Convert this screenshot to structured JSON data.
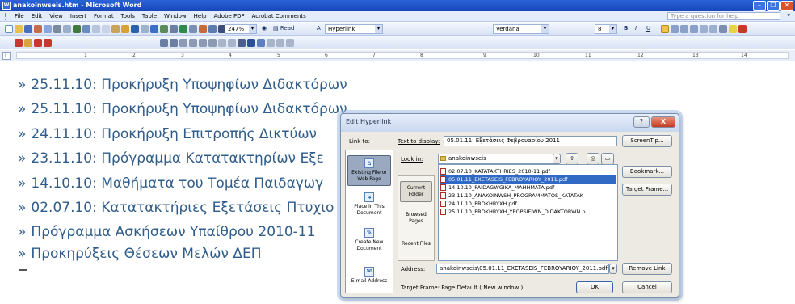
{
  "window": {
    "title": "anakoinwseis.htm - Microsoft Word",
    "controls": [
      "–",
      "❐",
      "✕"
    ]
  },
  "menu": {
    "items": [
      "File",
      "Edit",
      "View",
      "Insert",
      "Format",
      "Tools",
      "Table",
      "Window",
      "Help",
      "Adobe PDF",
      "Acrobat Comments"
    ],
    "help_placeholder": "Type a question for help"
  },
  "toolbar": {
    "zoom": "247%",
    "read_label": "Read",
    "style": "Hyperlink",
    "font": "Verdana",
    "size": "8"
  },
  "ruler": {
    "marks": [
      "1",
      "2",
      "3",
      "4",
      "5",
      "6",
      "7",
      "8",
      "9",
      "10",
      "11",
      "12",
      "13",
      "14"
    ]
  },
  "document": {
    "links": [
      {
        "text": "25.11.10: Προκήρυξη Υποψηφίων Διδακτόρων"
      },
      {
        "text": "25.11.10: Προκήρυξη Υποψηφίων Διδακτόρων"
      },
      {
        "text": "24.11.10: Προκήρυξη Επιτροπής Δικτύων"
      },
      {
        "text": "23.11.10: Πρόγραμμα Κατατακτηρίων Εξε"
      },
      {
        "text": "14.10.10: Μαθήματα του Τομέα Παιδαγωγ"
      },
      {
        "text": "02.07.10: Κατατακτήριες Εξετάσεις Πτυχιο"
      },
      {
        "text": "Πρόγραμμα Ασκήσεων Υπαίθρου 2010-11"
      },
      {
        "text": "Προκηρύξεις Θέσεων Μελών ΔΕΠ"
      }
    ],
    "bullet": "»"
  },
  "dialog": {
    "title": "Edit Hyperlink",
    "title_buttons": [
      "?",
      "X"
    ],
    "link_to_label": "Link to:",
    "text_display_label": "Text to display:",
    "text_display_value": "05.01.11: Εξετάσεις Φεβρουαρίου 2011",
    "screentip_button": "ScreenTip...",
    "look_in_label": "Look in:",
    "look_in_value": "anakoinwseis",
    "link_bar": [
      {
        "label": "Existing File or Web Page",
        "selected": true
      },
      {
        "label": "Place in This Document",
        "selected": false
      },
      {
        "label": "Create New Document",
        "selected": false
      },
      {
        "label": "E-mail Address",
        "selected": false
      }
    ],
    "inner_bar": [
      {
        "label": "Current Folder",
        "selected": true
      },
      {
        "label": "Browsed Pages",
        "selected": false
      },
      {
        "label": "Recent Files",
        "selected": false
      }
    ],
    "files": [
      {
        "name": "02.07.10_KATATAKTHRIES_2010-11.pdf",
        "selected": false
      },
      {
        "name": "05.01.11_EXETASEIS_FEBROYARIOY_2011.pdf",
        "selected": true
      },
      {
        "name": "14.10.10_PAIDAGWGIKA_MAHHMATA.pdf",
        "selected": false
      },
      {
        "name": "23.11.10_ANAKOINWSH_PROGRAMMATOS_KATATAK",
        "selected": false
      },
      {
        "name": "24.11.10_PROKHRYXH.pdf",
        "selected": false
      },
      {
        "name": "25.11.10_PROKHRYXH_YPOPSIFIWN_DIDAKTORWN.p",
        "selected": false
      }
    ],
    "bookmark_button": "Bookmark...",
    "target_frame_button": "Target Frame...",
    "address_label": "Address:",
    "address_value": "anakoinwseis\\05.01.11_EXETASEIS_FEBROYARIOY_2011.pdf",
    "remove_link_button": "Remove Link",
    "target_frame_text": "Target Frame: Page Default ( New window )",
    "ok_button": "OK",
    "cancel_button": "Cancel"
  }
}
